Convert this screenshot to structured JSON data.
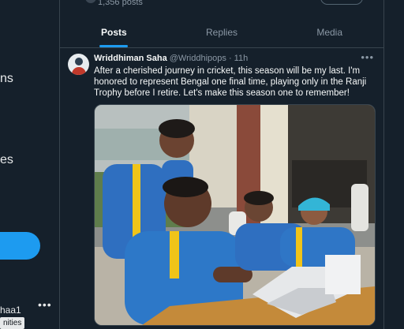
{
  "sidebar": {
    "frag_1": "ns",
    "frag_2": "es",
    "handle_frag": "haa1",
    "tooltip": "nities"
  },
  "profile": {
    "posts_count": "1,356 posts"
  },
  "tabs": [
    {
      "label": "Posts",
      "active": true
    },
    {
      "label": "Replies",
      "active": false
    },
    {
      "label": "Media",
      "active": false
    }
  ],
  "tweet": {
    "author_name": "Wriddhiman Saha",
    "author_handle": "@Wriddhipops",
    "separator": "·",
    "time": "11h",
    "text": "After a cherished journey in cricket, this season will be my last. I'm honored to represent Bengal one final time, playing only in the Ranji Trophy before I retire. Let's make this season one to remember!",
    "more_icon": "more-horizontal-icon"
  },
  "colors": {
    "background": "#15202b",
    "accent": "#1d9bf0",
    "text_primary": "#f7f9f9",
    "text_secondary": "#8b98a5",
    "border": "#38444d"
  }
}
